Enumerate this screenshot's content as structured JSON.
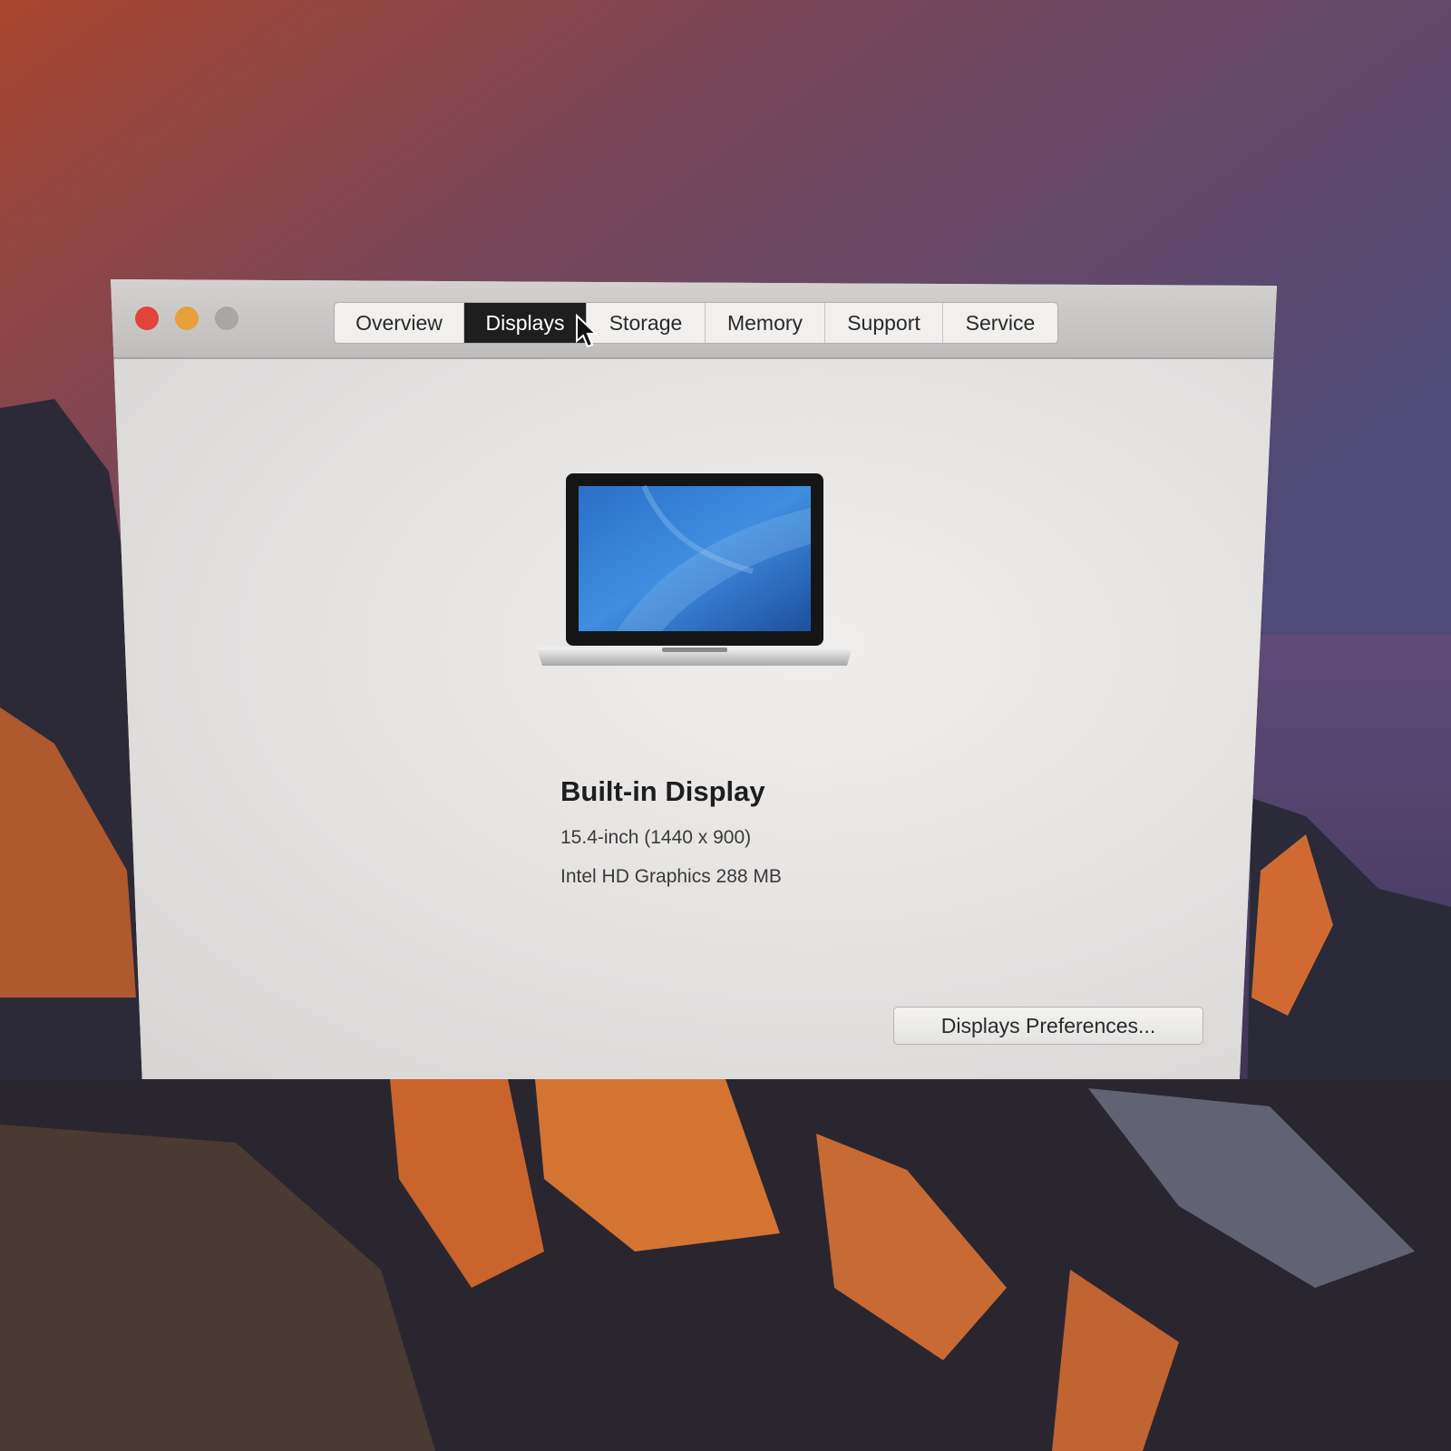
{
  "window": {
    "traffic_lights": [
      {
        "name": "close",
        "color": "#e0443a"
      },
      {
        "name": "minimize",
        "color": "#e8a03a"
      },
      {
        "name": "zoom",
        "color": "#a9a7a6"
      }
    ],
    "tabs": [
      {
        "label": "Overview"
      },
      {
        "label": "Displays",
        "active": true
      },
      {
        "label": "Storage"
      },
      {
        "label": "Memory"
      },
      {
        "label": "Support"
      },
      {
        "label": "Service"
      }
    ]
  },
  "display": {
    "title": "Built-in Display",
    "size": "15.4-inch (1440 x 900)",
    "graphics": "Intel HD Graphics 288 MB"
  },
  "buttons": {
    "preferences": "Displays Preferences..."
  }
}
